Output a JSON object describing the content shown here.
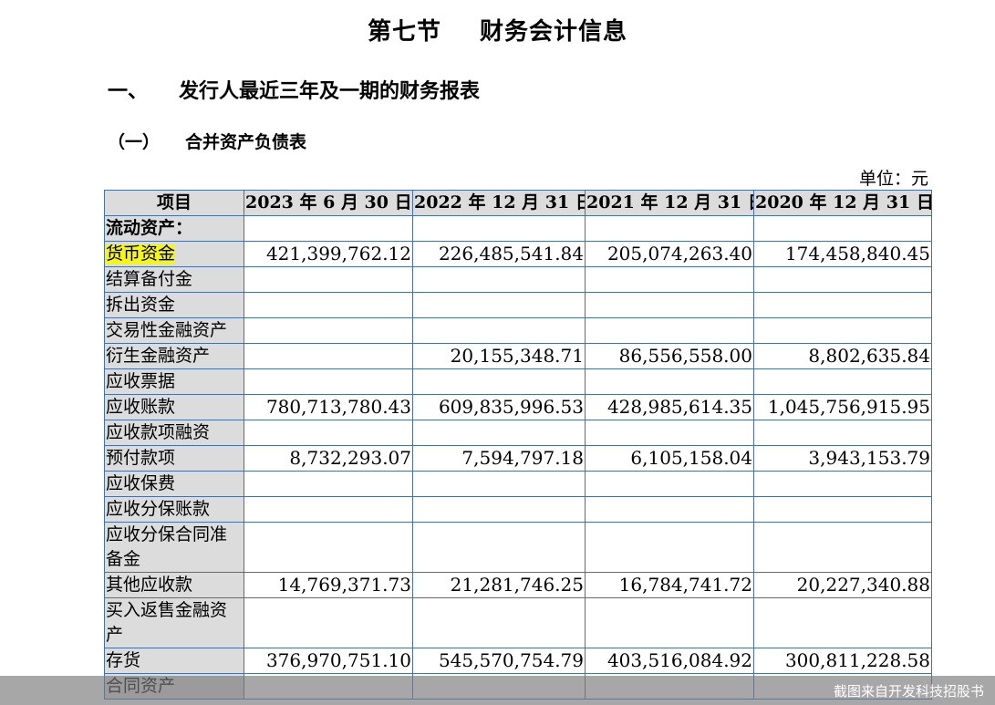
{
  "section": {
    "number": "第七节",
    "title": "财务会计信息"
  },
  "heading1": {
    "number": "一、",
    "text": "发行人最近三年及一期的财务报表"
  },
  "heading2": {
    "number": "（一）",
    "text": "合并资产负债表"
  },
  "unit": "单位：元",
  "table": {
    "headers": [
      "项目",
      "2023 年 6 月 30 日",
      "2022 年 12 月 31 日",
      "2021 年 12 月 31 日",
      "2020 年 12 月 31 日"
    ],
    "rows": [
      {
        "label": "流动资产：",
        "values": [
          "",
          "",
          "",
          ""
        ]
      },
      {
        "label": "货币资金",
        "values": [
          "421,399,762.12",
          "226,485,541.84",
          "205,074,263.40",
          "174,458,840.45"
        ]
      },
      {
        "label": "结算备付金",
        "values": [
          "",
          "",
          "",
          ""
        ]
      },
      {
        "label": "拆出资金",
        "values": [
          "",
          "",
          "",
          ""
        ]
      },
      {
        "label": "交易性金融资产",
        "values": [
          "",
          "",
          "",
          ""
        ]
      },
      {
        "label": "衍生金融资产",
        "values": [
          "",
          "20,155,348.71",
          "86,556,558.00",
          "8,802,635.84"
        ]
      },
      {
        "label": "应收票据",
        "values": [
          "",
          "",
          "",
          ""
        ]
      },
      {
        "label": "应收账款",
        "values": [
          "780,713,780.43",
          "609,835,996.53",
          "428,985,614.35",
          "1,045,756,915.95"
        ]
      },
      {
        "label": "应收款项融资",
        "values": [
          "",
          "",
          "",
          ""
        ]
      },
      {
        "label": "预付款项",
        "values": [
          "8,732,293.07",
          "7,594,797.18",
          "6,105,158.04",
          "3,943,153.79"
        ]
      },
      {
        "label": "应收保费",
        "values": [
          "",
          "",
          "",
          ""
        ]
      },
      {
        "label": "应收分保账款",
        "values": [
          "",
          "",
          "",
          ""
        ]
      },
      {
        "label": "应收分保合同准备金",
        "values": [
          "",
          "",
          "",
          ""
        ]
      },
      {
        "label": "其他应收款",
        "values": [
          "14,769,371.73",
          "21,281,746.25",
          "16,784,741.72",
          "20,227,340.88"
        ]
      },
      {
        "label": "买入返售金融资产",
        "values": [
          "",
          "",
          "",
          ""
        ]
      },
      {
        "label": "存货",
        "values": [
          "376,970,751.10",
          "545,570,754.79",
          "403,516,084.92",
          "300,811,228.58"
        ]
      },
      {
        "label": "合同资产",
        "values": [
          "",
          "",
          "",
          ""
        ]
      }
    ]
  },
  "watermark": "截图来自开发科技招股书",
  "colors": {
    "border": "#4a6fa5",
    "label_bg": "#dcdcdc",
    "highlight": "#f5f51c"
  }
}
